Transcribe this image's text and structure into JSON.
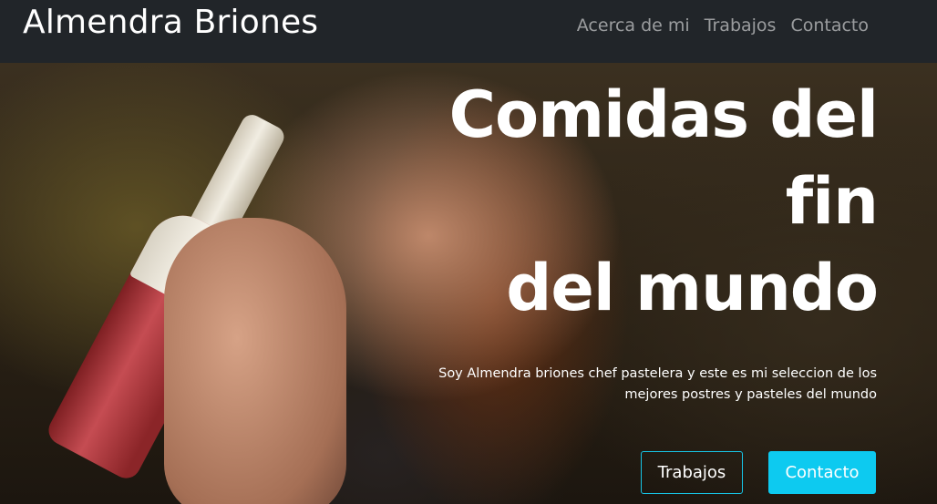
{
  "navbar": {
    "brand": "Almendra Briones",
    "links": [
      {
        "label": "Acerca de mi"
      },
      {
        "label": "Trabajos"
      },
      {
        "label": "Contacto"
      }
    ]
  },
  "hero": {
    "title": "Comidas del\nfin\ndel mundo",
    "subtitle": "Soy Almendra briones chef pastelera y este es mi seleccion de los mejores postres y pasteles del mundo",
    "buttons": [
      {
        "label": "Trabajos",
        "style": "outline"
      },
      {
        "label": "Contacto",
        "style": "solid"
      }
    ]
  },
  "colors": {
    "navbar_bg": "#212529",
    "accent": "#0dcaf0"
  }
}
